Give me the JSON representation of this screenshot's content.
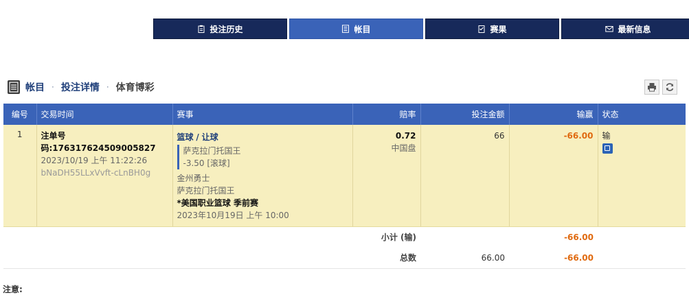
{
  "nav": {
    "items": [
      {
        "label": "投注历史",
        "icon": "clipboard-icon",
        "active": false
      },
      {
        "label": "帐目",
        "icon": "ledger-icon",
        "active": true
      },
      {
        "label": "赛果",
        "icon": "results-icon",
        "active": false
      },
      {
        "label": "最新信息",
        "icon": "mail-icon",
        "active": false
      }
    ]
  },
  "breadcrumb": {
    "items": [
      "帐目",
      "投注详情",
      "体育博彩"
    ],
    "separator": "·"
  },
  "table": {
    "headers": [
      "编号",
      "交易时间",
      "赛事",
      "赔率",
      "投注金额",
      "输赢",
      "状态"
    ],
    "row": {
      "no": "1",
      "ticket_label": "注单号",
      "ticket_no": "码:176317624509005827",
      "time": "2023/10/19 上午 11:22:26",
      "code": "bNaDH55LLxVvft-cLnBH0g",
      "sport": "篮球",
      "slash": "/",
      "bet_type": "让球",
      "selection": "萨克拉门托国王",
      "handicap": "-3.50 [滚球]",
      "home_team": "金州勇士",
      "away_team": "萨克拉门托国王",
      "league": "*美国职业篮球 季前赛",
      "match_time": "2023年10月19日 上午 10:00",
      "odds": "0.72",
      "odds_type": "中国盘",
      "stake": "66",
      "win_loss": "-66.00",
      "status": "输"
    },
    "subtotal": {
      "label": "小计 (输)",
      "win_loss": "-66.00"
    },
    "total": {
      "label": "总数",
      "stake": "66.00",
      "win_loss": "-66.00"
    }
  },
  "notice_label": "注意:",
  "colors": {
    "header_bg": "#3a63b8",
    "nav_bg": "#17295a",
    "row_bg": "#f7efbf",
    "negative": "#e06a10"
  }
}
